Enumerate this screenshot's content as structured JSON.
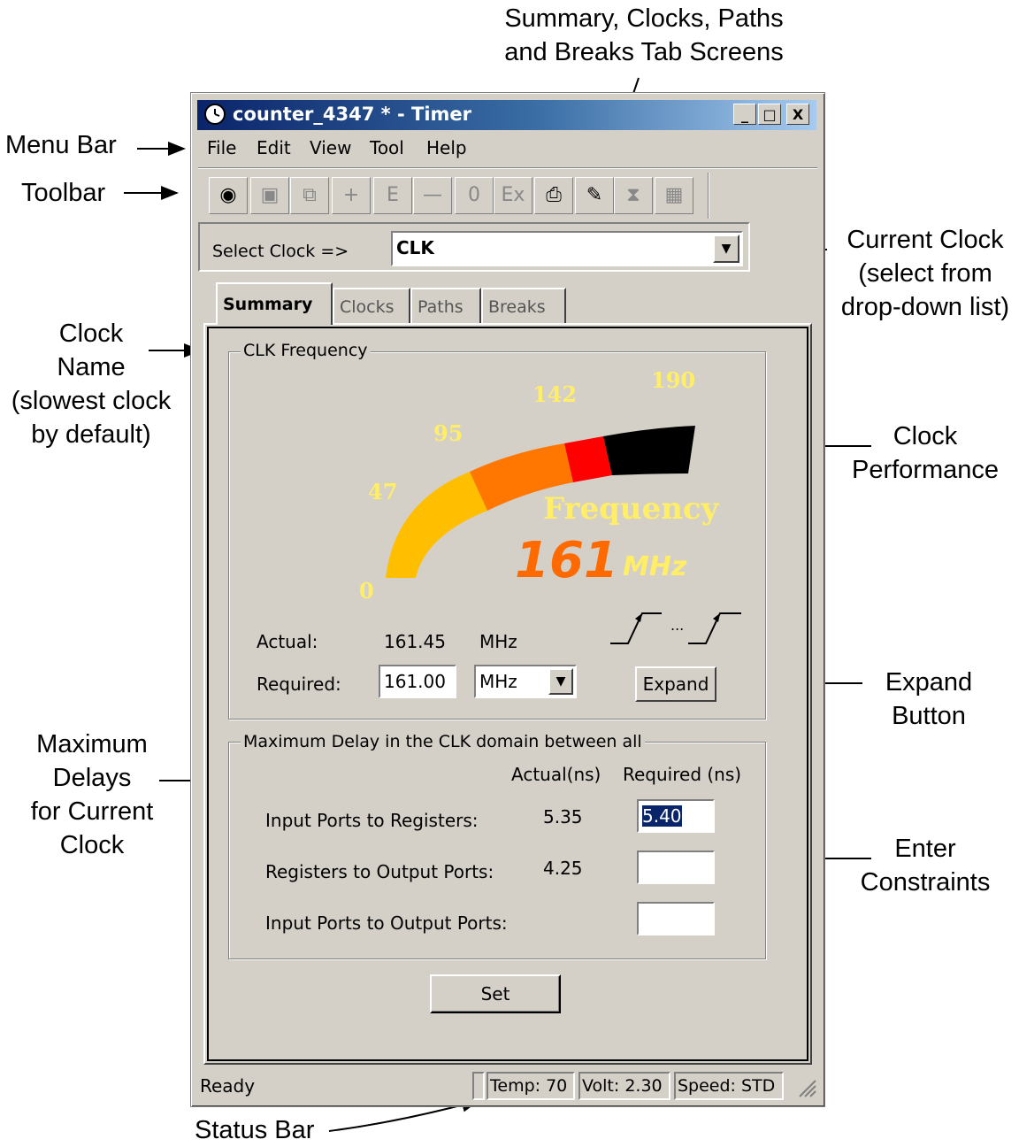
{
  "annotations": {
    "menu_bar": "Menu Bar",
    "toolbar": "Toolbar",
    "tab_screens": [
      "Summary, Clocks, Paths",
      "and Breaks Tab Screens"
    ],
    "current_clock": [
      "Current Clock",
      "(select from",
      "drop-down list)"
    ],
    "clock_name": [
      "Clock",
      "Name",
      "(slowest clock",
      "by default)"
    ],
    "clock_performance": [
      "Clock",
      "Performance"
    ],
    "expand_button": [
      "Expand",
      "Button"
    ],
    "maximum_delays": [
      "Maximum",
      "Delays",
      "for Current",
      "Clock"
    ],
    "enter_constraints": [
      "Enter",
      "Constraints"
    ],
    "status_bar": "Status Bar"
  },
  "window": {
    "title": "counter_4347 *  - Timer",
    "controls": [
      "_",
      "□",
      "X"
    ]
  },
  "menu": [
    "File",
    "Edit",
    "View",
    "Tool",
    "Help"
  ],
  "toolbar_icons": [
    "timer-icon",
    "save-icon",
    "copy-icon",
    "plus-icon",
    "e-icon",
    "minus-icon",
    "zero-icon",
    "ex-icon",
    "print-icon",
    "inspect-icon",
    "hourglass-icon",
    "grid-icon"
  ],
  "toolbar_glyphs": [
    "◉",
    "▣",
    "⧉",
    "+",
    "E",
    "—",
    "0",
    "Ex",
    "⎙",
    "✎",
    "⧗",
    "▦"
  ],
  "clock_select": {
    "label": "Select Clock =>",
    "value": "CLK"
  },
  "tabs": [
    "Summary",
    "Clocks",
    "Paths",
    "Breaks"
  ],
  "frequency": {
    "group_title": "CLK Frequency",
    "gauge_labels": [
      "0",
      "47",
      "95",
      "142",
      "190"
    ],
    "gauge_caption": "Frequency",
    "value": "161",
    "unit": "MHz",
    "actual_label": "Actual:",
    "actual_value": "161.45",
    "actual_unit": "MHz",
    "required_label": "Required:",
    "required_value": "161.00",
    "required_unit": "MHz",
    "expand_label": "Expand",
    "waveform_dots": "..."
  },
  "delays": {
    "group_title": "Maximum Delay in the CLK domain between all",
    "col_actual": "Actual(ns)",
    "col_required": "Required (ns)",
    "rows": [
      {
        "label": "Input Ports to Registers:",
        "actual": "5.35",
        "required": "5.40"
      },
      {
        "label": "Registers to Output Ports:",
        "actual": "4.25",
        "required": ""
      },
      {
        "label": "Input Ports to Output Ports:",
        "actual": "",
        "required": ""
      }
    ],
    "set_label": "Set"
  },
  "statusbar": {
    "ready": "Ready",
    "temp": "Temp: 70",
    "volt": "Volt: 2.30",
    "speed": "Speed: STD"
  },
  "colors": {
    "gauge_segments": [
      "#ffbf00",
      "#ff7700",
      "#ff0000",
      "#000000"
    ],
    "freq_value": "#ff6a00",
    "caption": "#ffee66"
  }
}
